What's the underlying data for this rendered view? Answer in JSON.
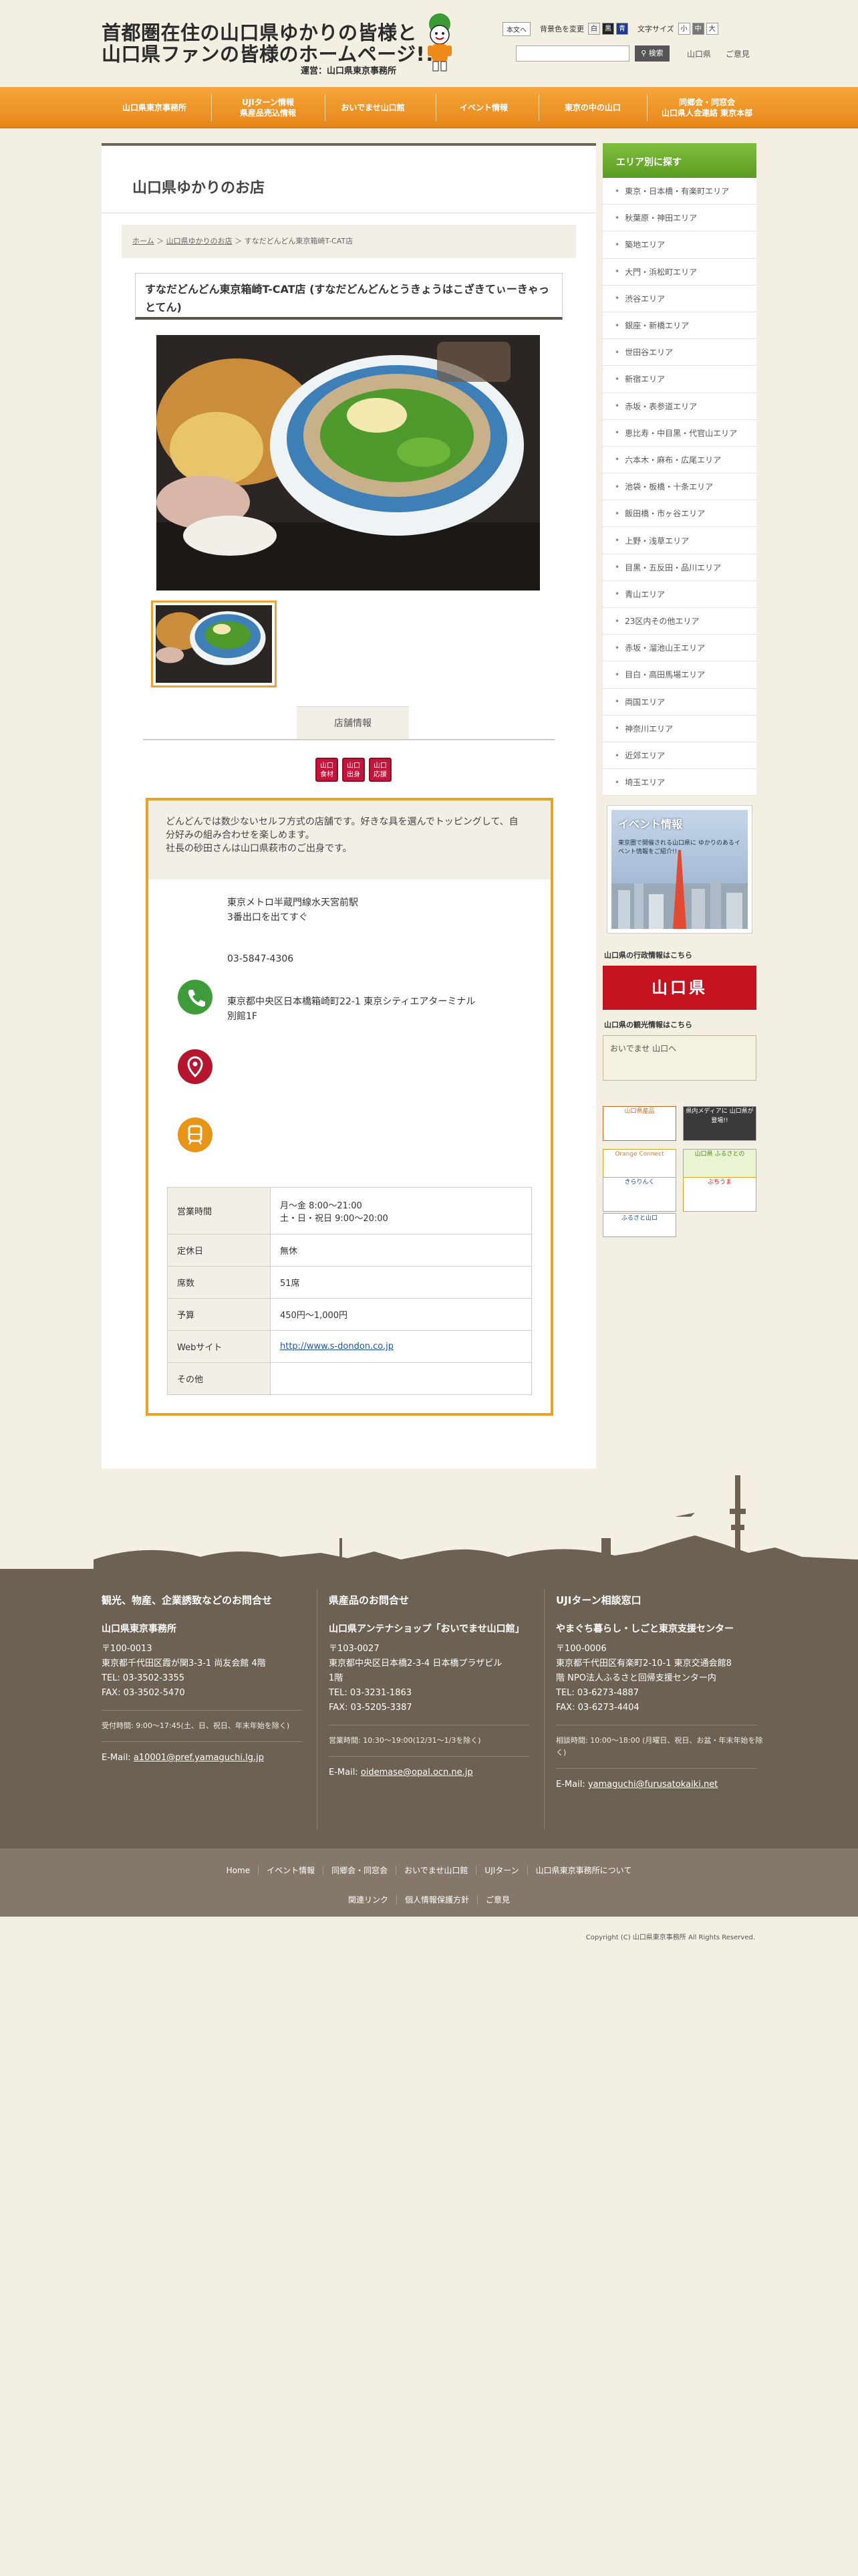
{
  "header": {
    "logo_line1": "首都圏在住の山口県ゆかりの皆様と",
    "logo_line2": "山口県ファンの皆様のホームページ!!",
    "operator": "運営：山口県東京事務所",
    "skip_link": "本文へ",
    "bg_color_label": "背景色を変更",
    "bg_colors": [
      "白",
      "黒",
      "青"
    ],
    "font_size_label": "文字サイズ",
    "font_sizes": [
      "小",
      "中",
      "大"
    ],
    "search_placeholder": "",
    "search_button": "検索",
    "links": [
      "山口県",
      "ご意見"
    ]
  },
  "nav": [
    {
      "line1": "山口県東京事務所",
      "line2": ""
    },
    {
      "line1": "UJIターン情報",
      "line2": "県産品売込情報"
    },
    {
      "line1": "おいでませ山口館",
      "line2": ""
    },
    {
      "line1": "イベント情報",
      "line2": ""
    },
    {
      "line1": "東京の中の山口",
      "line2": ""
    },
    {
      "line1": "同郷会・同窓会",
      "line2": "山口県人会連絡 東京本部"
    }
  ],
  "main": {
    "page_title": "山口県ゆかりのお店",
    "breadcrumb": [
      "ホーム",
      "山口県ゆかりのお店",
      "すなだどんどん東京箱崎T-CAT店"
    ],
    "shop_title": "すなだどんどん東京箱崎T-CAT店 (すなだどんどんとうきょうはこざきてぃーきゃっとてん)",
    "info_tab": "店舗情報",
    "tags": [
      {
        "l1": "山口",
        "l2": "食材"
      },
      {
        "l1": "山口",
        "l2": "出身"
      },
      {
        "l1": "山口",
        "l2": "応援"
      }
    ],
    "description_line1": "どんどんでは数少ないセルフ方式の店舗です。好きな具を選んでトッピングして、自",
    "description_line2": "分好みの組み合わせを楽しめます。",
    "description_line3": "社長の砂田さんは山口県萩市のご出身です。",
    "access_line1": "東京メトロ半蔵門線水天宮前駅",
    "access_line2": "3番出口を出てすぐ",
    "phone": "03-5847-4306",
    "address_line1": "東京都中央区日本橋箱崎町22-1 東京シティエアターミナル",
    "address_line2": "別館1F",
    "table": [
      {
        "label": "営業時間",
        "value": "月〜金 8:00〜21:00",
        "value2": "土・日・祝日 9:00〜20:00"
      },
      {
        "label": "定休日",
        "value": "無休",
        "value2": ""
      },
      {
        "label": "席数",
        "value": "51席",
        "value2": ""
      },
      {
        "label": "予算",
        "value": "450円〜1,000円",
        "value2": ""
      },
      {
        "label": "Webサイト",
        "value": "http://www.s-dondon.co.jp",
        "value2": ""
      },
      {
        "label": "その他",
        "value": "",
        "value2": ""
      }
    ]
  },
  "sidebar": {
    "area_heading": "エリア別に探す",
    "areas": [
      "東京・日本橋・有楽町エリア",
      "秋葉原・神田エリア",
      "築地エリア",
      "大門・浜松町エリア",
      "渋谷エリア",
      "銀座・新橋エリア",
      "世田谷エリア",
      "新宿エリア",
      "赤坂・表参道エリア",
      "恵比寿・中目黒・代官山エリア",
      "六本木・麻布・広尾エリア",
      "池袋・板橋・十条エリア",
      "飯田橋・市ヶ谷エリア",
      "上野・浅草エリア",
      "目黒・五反田・品川エリア",
      "青山エリア",
      "23区内その他エリア",
      "赤坂・溜池山王エリア",
      "目白・高田馬場エリア",
      "両国エリア",
      "神奈川エリア",
      "近郊エリア",
      "埼玉エリア"
    ],
    "event_title": "イベント情報",
    "event_sub": "東京圏で開催される山口県に ゆかりのあるイベント情報をご紹介!!",
    "gov_label": "山口県の行政情報はこちら",
    "gov_banner": "山口県",
    "tourism_label": "山口県の観光情報はこちら",
    "tourism_banner": "おいでませ 山口へ",
    "small_banners": [
      "山口県産品",
      "県内メディアに 山口県が登場!!",
      "Orange Connect",
      "山口県 ふるさとの",
      "きらりんく",
      "ぶちうま",
      "ふるさと山口"
    ]
  },
  "footer": {
    "cols": [
      {
        "heading": "観光、物産、企業誘致などのお問合せ",
        "name": "山口県東京事務所",
        "lines": [
          "〒100-0013",
          "東京都千代田区霞が関3-3-1 尚友会館 4階",
          "TEL: 03-3502-3355",
          "FAX: 03-3502-5470"
        ],
        "hours": "受付時間: 9:00〜17:45(土、日、祝日、年末年始を除く)",
        "email_label": "E-Mail: ",
        "email": "a10001@pref.yamaguchi.lg.jp"
      },
      {
        "heading": "県産品のお問合せ",
        "name": "山口県アンテナショップ「おいでませ山口館」",
        "lines": [
          "〒103-0027",
          "東京都中央区日本橋2-3-4 日本橋プラザビル",
          "1階",
          "TEL: 03-3231-1863",
          "FAX: 03-5205-3387"
        ],
        "hours": "営業時間: 10:30〜19:00(12/31〜1/3を除く)",
        "email_label": "E-Mail: ",
        "email": "oidemase@opal.ocn.ne.jp"
      },
      {
        "heading": "UJIターン相談窓口",
        "name": "やまぐち暮らし・しごと東京支援センター",
        "lines": [
          "〒100-0006",
          "東京都千代田区有楽町2-10-1 東京交通会館8",
          "階 NPO法人ふるさと回帰支援センター内",
          "TEL: 03-6273-4887",
          "FAX: 03-6273-4404"
        ],
        "hours": "相談時間: 10:00〜18:00 (月曜日、祝日、お盆・年末年始を除く)",
        "email_label": "E-Mail: ",
        "email": "yamaguchi@furusatokaiki.net"
      }
    ],
    "nav_row1": [
      "Home",
      "イベント情報",
      "同郷会・同窓会",
      "おいでませ山口館",
      "UJIターン",
      "山口県東京事務所について"
    ],
    "nav_row2": [
      "関連リンク",
      "個人情報保護方針",
      "ご意見"
    ],
    "copyright": "Copyright (C) 山口県東京事務所 All Rights Reserved."
  }
}
